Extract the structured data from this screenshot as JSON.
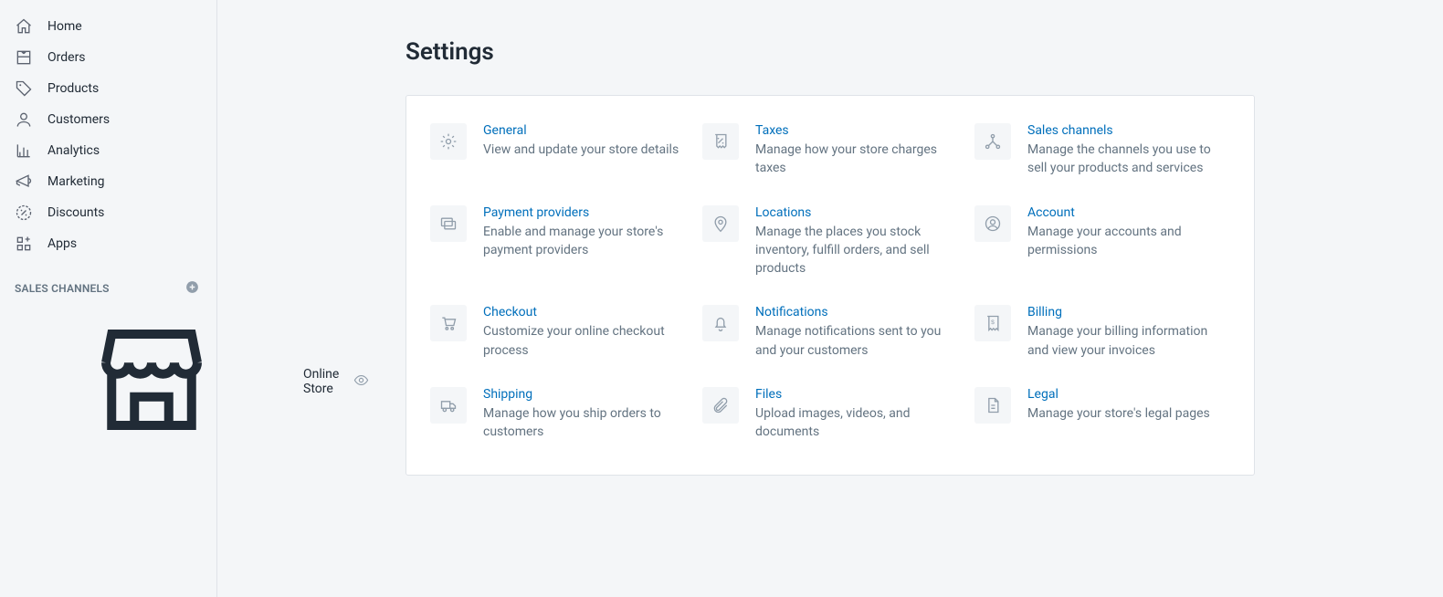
{
  "sidebar": {
    "nav": [
      {
        "id": "home",
        "label": "Home"
      },
      {
        "id": "orders",
        "label": "Orders"
      },
      {
        "id": "products",
        "label": "Products"
      },
      {
        "id": "customers",
        "label": "Customers"
      },
      {
        "id": "analytics",
        "label": "Analytics"
      },
      {
        "id": "marketing",
        "label": "Marketing"
      },
      {
        "id": "discounts",
        "label": "Discounts"
      },
      {
        "id": "apps",
        "label": "Apps"
      }
    ],
    "sales_channels_header": "SALES CHANNELS",
    "channels": [
      {
        "id": "online-store",
        "label": "Online Store"
      }
    ]
  },
  "page": {
    "title": "Settings"
  },
  "tiles": [
    {
      "id": "general",
      "title": "General",
      "desc": "View and update your store details"
    },
    {
      "id": "taxes",
      "title": "Taxes",
      "desc": "Manage how your store charges taxes"
    },
    {
      "id": "sales-channels",
      "title": "Sales channels",
      "desc": "Manage the channels you use to sell your products and services"
    },
    {
      "id": "payment-providers",
      "title": "Payment providers",
      "desc": "Enable and manage your store's payment providers"
    },
    {
      "id": "locations",
      "title": "Locations",
      "desc": "Manage the places you stock inventory, fulfill orders, and sell products"
    },
    {
      "id": "account",
      "title": "Account",
      "desc": "Manage your accounts and permissions"
    },
    {
      "id": "checkout",
      "title": "Checkout",
      "desc": "Customize your online checkout process"
    },
    {
      "id": "notifications",
      "title": "Notifications",
      "desc": "Manage notifications sent to you and your customers"
    },
    {
      "id": "billing",
      "title": "Billing",
      "desc": "Manage your billing information and view your invoices"
    },
    {
      "id": "shipping",
      "title": "Shipping",
      "desc": "Manage how you ship orders to customers"
    },
    {
      "id": "files",
      "title": "Files",
      "desc": "Upload images, videos, and documents"
    },
    {
      "id": "legal",
      "title": "Legal",
      "desc": "Manage your store's legal pages"
    }
  ]
}
